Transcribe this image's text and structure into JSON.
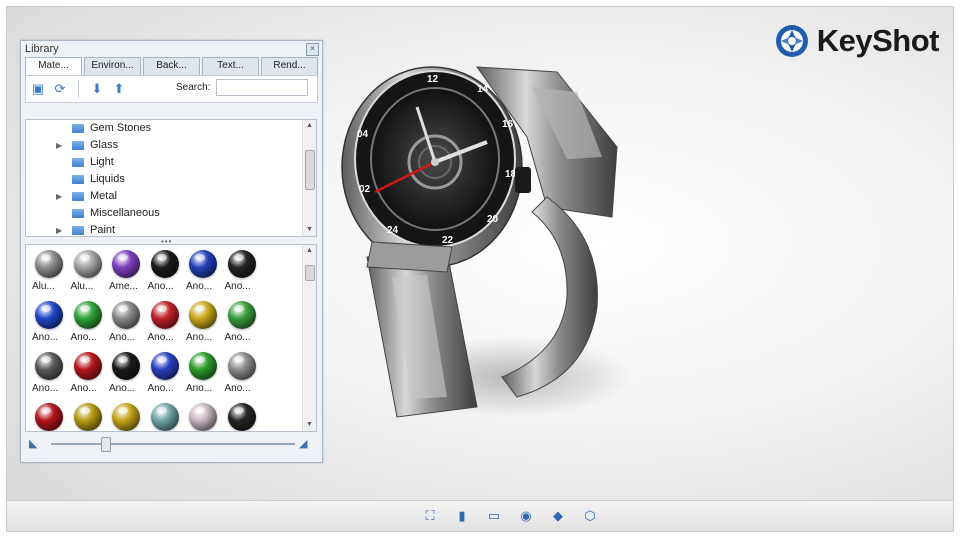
{
  "app": {
    "brand": "KeyShot"
  },
  "library": {
    "title": "Library",
    "tabs": [
      "Mate...",
      "Environ...",
      "Back...",
      "Text...",
      "Rend..."
    ],
    "search_label": "Search:",
    "search_value": "",
    "tree": [
      "Gem Stones",
      "Glass",
      "Light",
      "Liquids",
      "Metal",
      "Miscellaneous",
      "Paint"
    ],
    "tree_expandable": [
      false,
      true,
      false,
      false,
      true,
      false,
      true
    ],
    "swatches": [
      {
        "label": "Alu...",
        "color": "#8e8e8e"
      },
      {
        "label": "Alu...",
        "color": "#a4a4a4"
      },
      {
        "label": "Ame...",
        "color": "#7d3fc0"
      },
      {
        "label": "Ano...",
        "color": "#1b1b1b"
      },
      {
        "label": "Ano...",
        "color": "#2240b8"
      },
      {
        "label": "Ano...",
        "color": "#222222"
      },
      {
        "label": "Ano...",
        "color": "#1f47c6"
      },
      {
        "label": "Ano...",
        "color": "#2fa23a"
      },
      {
        "label": "Ano...",
        "color": "#8a8a8a"
      },
      {
        "label": "Ano...",
        "color": "#c0202a"
      },
      {
        "label": "Ano...",
        "color": "#c8a81c"
      },
      {
        "label": "Ano...",
        "color": "#3a9e3a"
      },
      {
        "label": "Ano...",
        "color": "#5a5a5a"
      },
      {
        "label": "Ano...",
        "color": "#b3161e"
      },
      {
        "label": "Ano...",
        "color": "#1a1a1a"
      },
      {
        "label": "Ano...",
        "color": "#2a40c0"
      },
      {
        "label": "Ano...",
        "color": "#2c9c2c"
      },
      {
        "label": "Ano...",
        "color": "#8c8c8c"
      },
      {
        "label": "",
        "color": "#b3141c"
      },
      {
        "label": "",
        "color": "#b49a12"
      },
      {
        "label": "",
        "color": "#c4a41a"
      },
      {
        "label": "",
        "color": "#6fa4a8"
      },
      {
        "label": "",
        "color": "#c9b6c0"
      },
      {
        "label": "",
        "color": "#262626"
      }
    ],
    "zoom_level": 0.22
  },
  "watch_numerals": [
    "12",
    "14",
    "16",
    "18",
    "20",
    "22",
    "24",
    "02",
    "04"
  ]
}
